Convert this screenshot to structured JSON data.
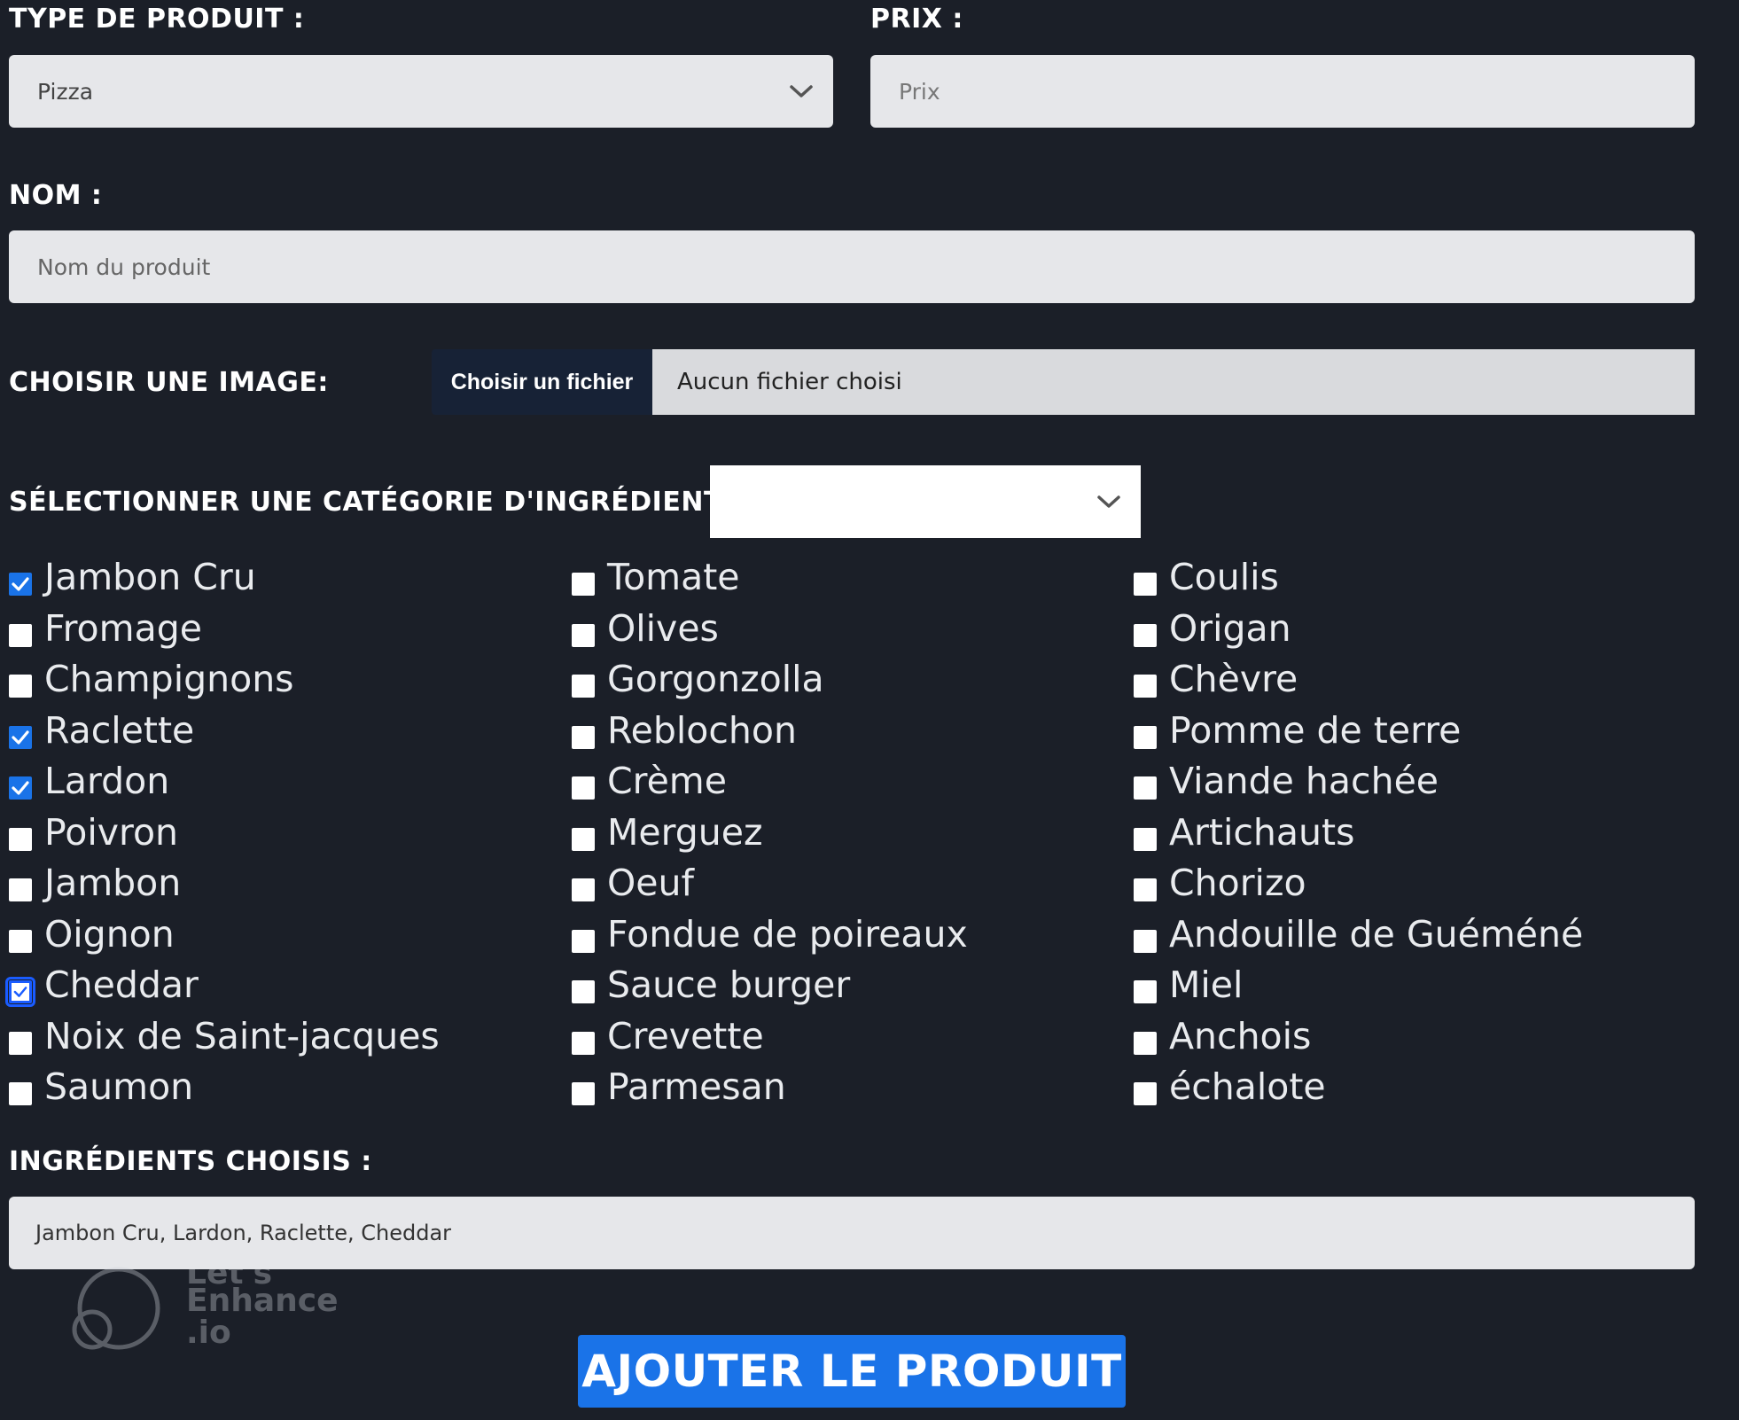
{
  "form": {
    "type_label": "TYPE DE PRODUIT :",
    "type_value": "Pizza",
    "price_label": "PRIX :",
    "price_placeholder": "Prix",
    "name_label": "NOM :",
    "name_placeholder": "Nom du produit",
    "image_label": "CHOISIR UNE IMAGE:",
    "file_button": "Choisir un fichier",
    "file_status": "Aucun fichier choisi",
    "category_label": "SÉLECTIONNER UNE CATÉGORIE D'INGRÉDIENT :",
    "category_value": "",
    "chosen_label": "INGRÉDIENTS CHOISIS :",
    "chosen_value": "Jambon Cru, Lardon, Raclette, Cheddar",
    "submit_label": "AJOUTER LE PRODUIT"
  },
  "ingredients": {
    "col1": [
      {
        "label": "Jambon Cru",
        "checked": true
      },
      {
        "label": "Fromage",
        "checked": false
      },
      {
        "label": "Champignons",
        "checked": false
      },
      {
        "label": "Raclette",
        "checked": true
      },
      {
        "label": "Lardon",
        "checked": true
      },
      {
        "label": "Poivron",
        "checked": false
      },
      {
        "label": "Jambon",
        "checked": false
      },
      {
        "label": "Oignon",
        "checked": false
      },
      {
        "label": "Cheddar",
        "checked": true,
        "focused": true
      },
      {
        "label": "Noix de Saint-jacques",
        "checked": false
      },
      {
        "label": "Saumon",
        "checked": false
      }
    ],
    "col2": [
      {
        "label": "Tomate",
        "checked": false
      },
      {
        "label": "Olives",
        "checked": false
      },
      {
        "label": "Gorgonzolla",
        "checked": false
      },
      {
        "label": "Reblochon",
        "checked": false
      },
      {
        "label": "Crème",
        "checked": false
      },
      {
        "label": "Merguez",
        "checked": false
      },
      {
        "label": "Oeuf",
        "checked": false
      },
      {
        "label": "Fondue de poireaux",
        "checked": false
      },
      {
        "label": "Sauce burger",
        "checked": false
      },
      {
        "label": "Crevette",
        "checked": false
      },
      {
        "label": "Parmesan",
        "checked": false
      }
    ],
    "col3": [
      {
        "label": "Coulis",
        "checked": false
      },
      {
        "label": "Origan",
        "checked": false
      },
      {
        "label": "Chèvre",
        "checked": false
      },
      {
        "label": "Pomme de terre",
        "checked": false
      },
      {
        "label": "Viande hachée",
        "checked": false
      },
      {
        "label": "Artichauts",
        "checked": false
      },
      {
        "label": "Chorizo",
        "checked": false
      },
      {
        "label": "Andouille de Guéméné",
        "checked": false
      },
      {
        "label": "Miel",
        "checked": false
      },
      {
        "label": "Anchois",
        "checked": false
      },
      {
        "label": "échalote",
        "checked": false
      }
    ]
  },
  "watermark": {
    "line1": "Let's",
    "line2": "Enhance",
    "line3": ".io"
  },
  "colors": {
    "background": "#1b1f28",
    "accent": "#1a73e8",
    "field": "#e6e7ea",
    "file_button": "#172236"
  }
}
